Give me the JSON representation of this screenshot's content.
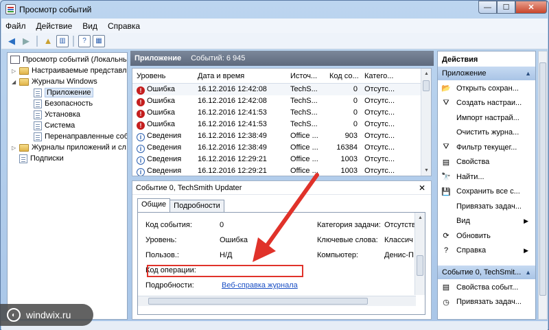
{
  "window": {
    "title": "Просмотр событий",
    "minimize": "—",
    "maximize": "☐",
    "close": "✕"
  },
  "menu": [
    "Файл",
    "Действие",
    "Вид",
    "Справка"
  ],
  "tree": {
    "root": "Просмотр событий (Локальны",
    "custom_views": "Настраиваемые представле",
    "windows_logs": "Журналы Windows",
    "logs": [
      "Приложение",
      "Безопасность",
      "Установка",
      "Система",
      "Перенаправленные соб"
    ],
    "app_service_logs": "Журналы приложений и сл",
    "subscriptions": "Подписки"
  },
  "center": {
    "title": "Приложение",
    "count": "Событий: 6 945"
  },
  "columns": [
    "Уровень",
    "Дата и время",
    "Источ...",
    "Код со...",
    "Катего..."
  ],
  "rows": [
    {
      "level": "Ошибка",
      "type": "error",
      "date": "16.12.2016 12:42:08",
      "source": "TechS...",
      "code": "0",
      "category": "Отсутс..."
    },
    {
      "level": "Ошибка",
      "type": "error",
      "date": "16.12.2016 12:42:08",
      "source": "TechS...",
      "code": "0",
      "category": "Отсутс..."
    },
    {
      "level": "Ошибка",
      "type": "error",
      "date": "16.12.2016 12:41:53",
      "source": "TechS...",
      "code": "0",
      "category": "Отсутс..."
    },
    {
      "level": "Ошибка",
      "type": "error",
      "date": "16.12.2016 12:41:53",
      "source": "TechS...",
      "code": "0",
      "category": "Отсутс..."
    },
    {
      "level": "Сведения",
      "type": "info",
      "date": "16.12.2016 12:38:49",
      "source": "Office ...",
      "code": "903",
      "category": "Отсутс..."
    },
    {
      "level": "Сведения",
      "type": "info",
      "date": "16.12.2016 12:38:49",
      "source": "Office ...",
      "code": "16384",
      "category": "Отсутс..."
    },
    {
      "level": "Сведения",
      "type": "info",
      "date": "16.12.2016 12:29:21",
      "source": "Office ...",
      "code": "1003",
      "category": "Отсутс..."
    },
    {
      "level": "Сведения",
      "type": "info",
      "date": "16.12.2016 12:29:21",
      "source": "Office ...",
      "code": "1003",
      "category": "Отсутс..."
    }
  ],
  "detail": {
    "title": "Событие 0, TechSmith Updater",
    "close": "✕",
    "tabs": [
      "Общие",
      "Подробности"
    ],
    "fields": {
      "event_code_label": "Код события:",
      "event_code": "0",
      "level_label": "Уровень:",
      "level": "Ошибка",
      "user_label": "Пользов.:",
      "user": "Н/Д",
      "opcode_label": "Код операции:",
      "more_label": "Подробности:",
      "more_link": "Веб-справка журнала",
      "task_label": "Категория задачи:",
      "task": "Отсутств",
      "keywords_label": "Ключевые слова:",
      "keywords": "Классич",
      "computer_label": "Компьютер:",
      "computer": "Денис-П"
    }
  },
  "actions": {
    "header": "Действия",
    "section1": "Приложение",
    "items1": [
      {
        "label": "Открыть сохран...",
        "icon": "folder-open-icon",
        "glyph": "📂"
      },
      {
        "label": "Создать настраи...",
        "icon": "filter-icon",
        "glyph": "⛛"
      },
      {
        "label": "Импорт настрай...",
        "icon": "blank-icon",
        "glyph": ""
      },
      {
        "label": "Очистить журна...",
        "icon": "blank-icon",
        "glyph": ""
      },
      {
        "label": "Фильтр текущег...",
        "icon": "filter-icon",
        "glyph": "⛛"
      },
      {
        "label": "Свойства",
        "icon": "properties-icon",
        "glyph": "▤"
      },
      {
        "label": "Найти...",
        "icon": "find-icon",
        "glyph": "🔭"
      },
      {
        "label": "Сохранить все с...",
        "icon": "save-icon",
        "glyph": "💾"
      },
      {
        "label": "Привязать задач...",
        "icon": "blank-icon",
        "glyph": ""
      },
      {
        "label": "Вид",
        "icon": "blank-icon",
        "glyph": "",
        "submenu": "▶"
      },
      {
        "label": "Обновить",
        "icon": "refresh-icon",
        "glyph": "⟳"
      },
      {
        "label": "Справка",
        "icon": "help-icon",
        "glyph": "?",
        "submenu": "▶"
      }
    ],
    "section2": "Событие 0, TechSmit...",
    "items2": [
      {
        "label": "Свойства событ...",
        "icon": "properties-icon",
        "glyph": "▤"
      },
      {
        "label": "Привязать задач...",
        "icon": "task-icon",
        "glyph": "◷"
      }
    ]
  },
  "watermark": "windwix.ru"
}
